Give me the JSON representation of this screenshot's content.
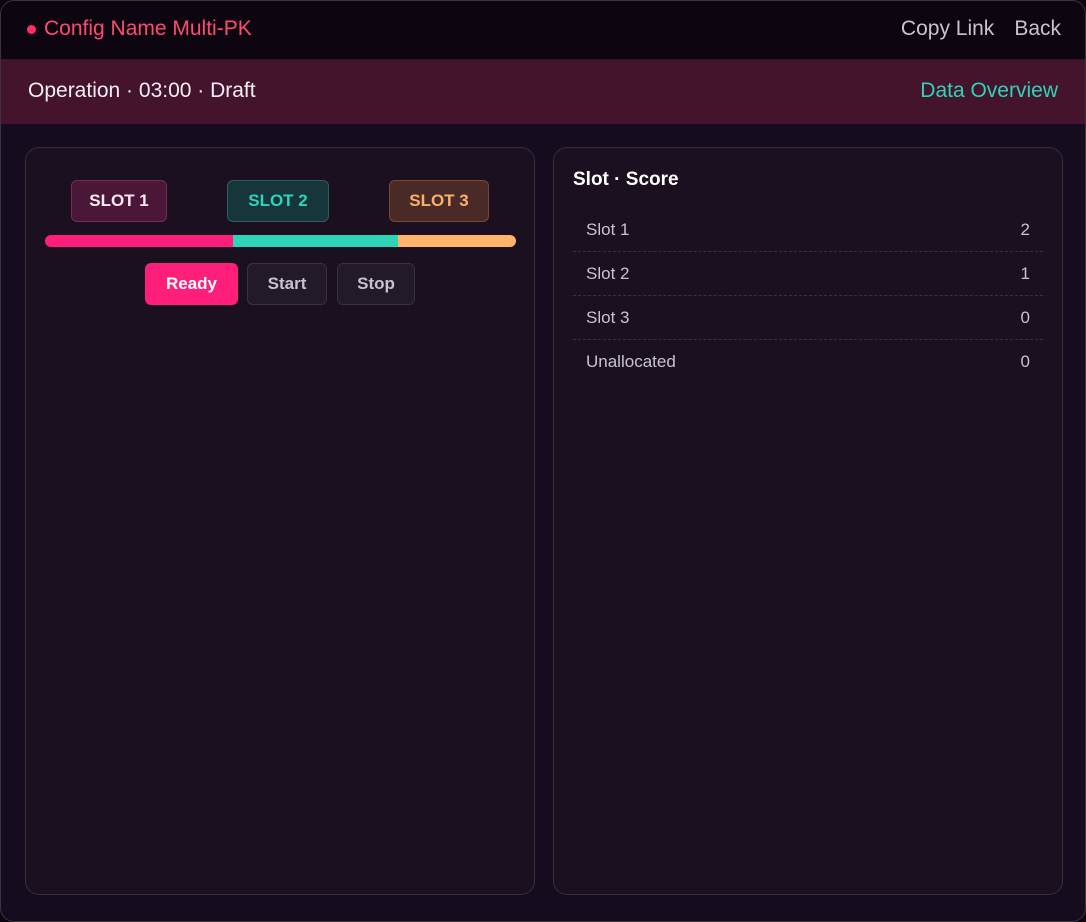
{
  "header": {
    "title": "Config Name Multi-PK",
    "copy_link": "Copy Link",
    "back": "Back"
  },
  "subheader": {
    "status": "Operation · 03:00 · Draft",
    "overview": "Data Overview"
  },
  "slots": [
    {
      "label": "SLOT 1",
      "color": "#ff1f7a",
      "share": 0.4
    },
    {
      "label": "SLOT 2",
      "color": "#2fd3b8",
      "share": 0.35
    },
    {
      "label": "SLOT 3",
      "color": "#ffb46a",
      "share": 0.25
    }
  ],
  "controls": {
    "ready": "Ready",
    "start": "Start",
    "stop": "Stop"
  },
  "scoreboard": {
    "title": "Slot · Score",
    "rows": [
      {
        "label": "Slot 1",
        "value": "2"
      },
      {
        "label": "Slot 2",
        "value": "1"
      },
      {
        "label": "Slot 3",
        "value": "0"
      },
      {
        "label": "Unallocated",
        "value": "0"
      }
    ]
  },
  "colors": {
    "accent": "#ff1f7a",
    "teal": "#2fd3b8",
    "orange": "#ffb46a"
  }
}
